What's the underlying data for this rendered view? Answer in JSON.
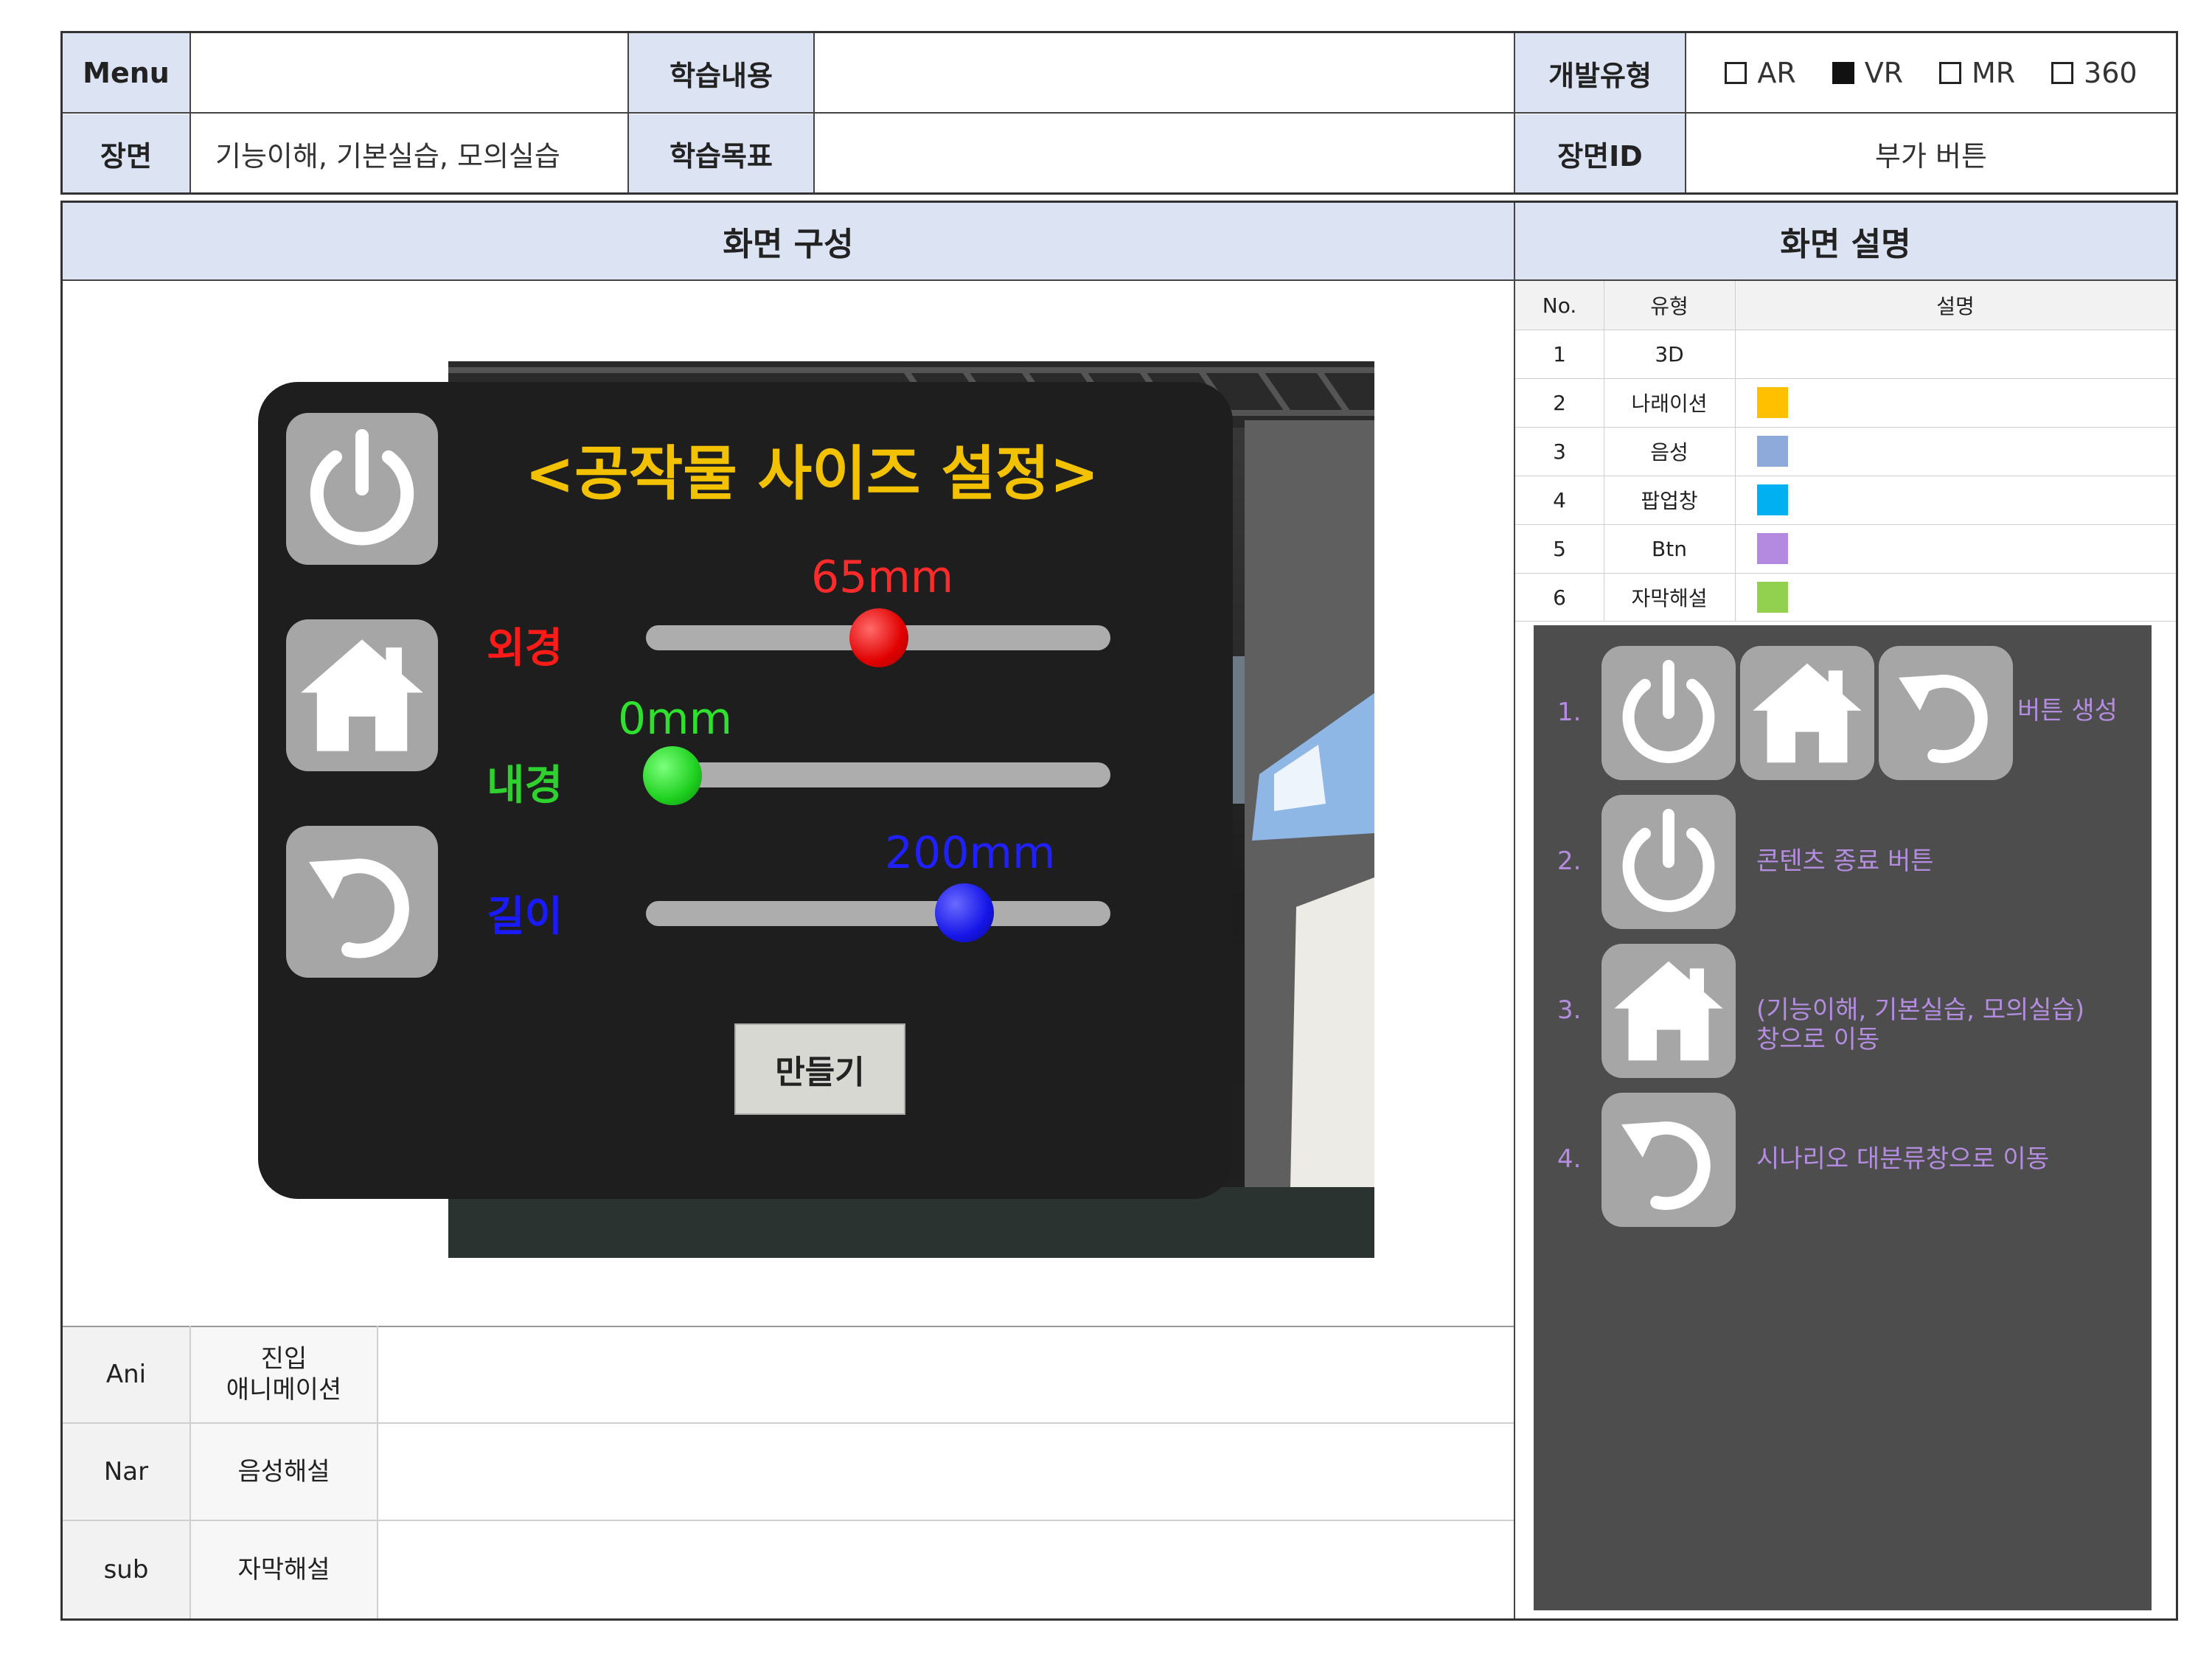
{
  "header": {
    "menu_label": "Menu",
    "menu_value": "",
    "content_label": "학습내용",
    "content_value": "",
    "dev_type_label": "개발유형",
    "dev_types": [
      {
        "label": "AR",
        "checked": false
      },
      {
        "label": "VR",
        "checked": true
      },
      {
        "label": "MR",
        "checked": false
      },
      {
        "label": "360",
        "checked": false
      }
    ],
    "scene_label": "장면",
    "scene_value": "기능이해, 기본실습, 모의실습",
    "goal_label": "학습목표",
    "goal_value": "",
    "scene_id_label": "장면ID",
    "scene_id_value": "부가 버튼"
  },
  "screen_composition_title": "화면 구성",
  "screen_description_title": "화면 설명",
  "legend": {
    "headers": [
      "No.",
      "유형",
      "설명"
    ],
    "rows": [
      {
        "no": "1",
        "type": "3D",
        "color": ""
      },
      {
        "no": "2",
        "type": "나래이션",
        "color": "#ffc000"
      },
      {
        "no": "3",
        "type": "음성",
        "color": "#8eaadb"
      },
      {
        "no": "4",
        "type": "팝업창",
        "color": "#00b0f0"
      },
      {
        "no": "5",
        "type": "Btn",
        "color": "#b38ae0"
      },
      {
        "no": "6",
        "type": "자막해설",
        "color": "#92d050"
      }
    ]
  },
  "game_ui": {
    "title": "<공작물 사이즈 설정>",
    "sliders": [
      {
        "label": "외경",
        "value_text": "65mm",
        "position": 0.5,
        "color": "#ff1a1a"
      },
      {
        "label": "내경",
        "value_text": "0mm",
        "position": 0.0,
        "color": "#22dd22"
      },
      {
        "label": "길이",
        "value_text": "200mm",
        "position": 0.72,
        "color": "#1a1aff"
      }
    ],
    "make_button": "만들기",
    "side_buttons": [
      "power-icon",
      "home-icon",
      "undo-icon"
    ]
  },
  "explanation": {
    "items": [
      {
        "num": "1.",
        "text": "버튼 생성"
      },
      {
        "num": "2.",
        "text": "콘텐츠 종료 버튼"
      },
      {
        "num": "3.",
        "line1": "(기능이해, 기본실습, 모의실습)",
        "line2": "창으로 이동"
      },
      {
        "num": "4.",
        "text": "시나리오 대분류창으로 이동"
      }
    ],
    "text_color": "#b48de0"
  },
  "bottom_rows": [
    {
      "code": "Ani",
      "label_line1": "진입",
      "label_line2": "애니메이션",
      "value": ""
    },
    {
      "code": "Nar",
      "label": "음성해설",
      "value": ""
    },
    {
      "code": "sub",
      "label": "자막해설",
      "value": ""
    }
  ]
}
